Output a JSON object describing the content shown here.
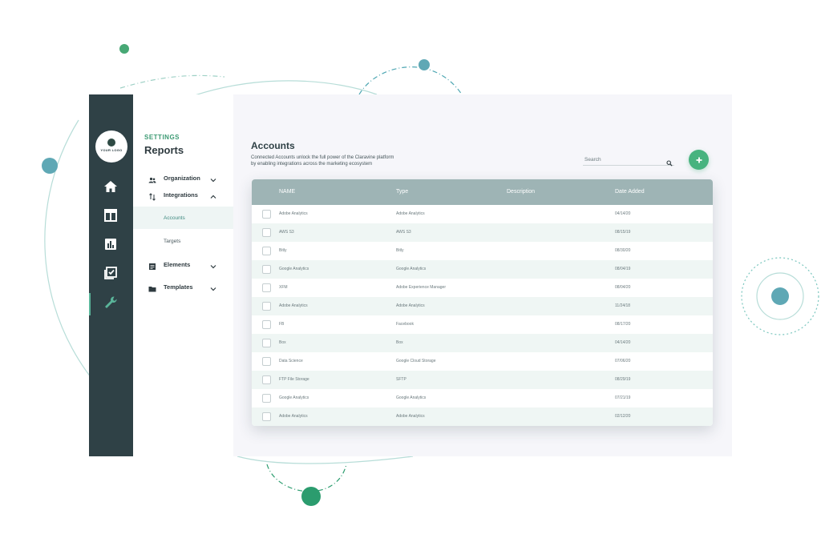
{
  "brand": {
    "logo_text": "YOUR LOGO"
  },
  "rail": {
    "items": [
      {
        "icon": "home-icon"
      },
      {
        "icon": "table-layout-icon"
      },
      {
        "icon": "bar-chart-icon"
      },
      {
        "icon": "checklist-icon"
      },
      {
        "icon": "wrench-icon",
        "active": true
      }
    ]
  },
  "sidebar": {
    "eyebrow": "SETTINGS",
    "title": "Reports",
    "items": [
      {
        "label": "Organization",
        "icon": "users-icon",
        "chevron": "down"
      },
      {
        "label": "Integrations",
        "icon": "sort-arrows-icon",
        "chevron": "up"
      },
      {
        "label": "Elements",
        "icon": "list-icon",
        "chevron": "down"
      },
      {
        "label": "Templates",
        "icon": "folder-icon",
        "chevron": "down"
      }
    ],
    "subitems": [
      {
        "label": "Accounts",
        "active": true
      },
      {
        "label": "Targets",
        "active": false
      }
    ]
  },
  "main": {
    "title": "Accounts",
    "description_line1": "Connected Accounts unlock the full power of the Claravine platform",
    "description_line2": "by enabling integrations across the marketing ecosystem",
    "search_placeholder": "Search"
  },
  "table": {
    "headers": [
      "NAME",
      "Type",
      "Description",
      "Date Added"
    ],
    "rows": [
      {
        "name": "Adobe Analytics",
        "type": "Adobe Analytics",
        "description": "",
        "date": "04/14/20"
      },
      {
        "name": "AWS S3",
        "type": "AWS S3",
        "description": "",
        "date": "08/15/19"
      },
      {
        "name": "Bitly",
        "type": "Bitly",
        "description": "",
        "date": "08/30/20"
      },
      {
        "name": "Google Analytics",
        "type": "Google Analytics",
        "description": "",
        "date": "08/04/19"
      },
      {
        "name": "XFM",
        "type": "Adobe Experience Manager",
        "description": "",
        "date": "08/04/20"
      },
      {
        "name": "Adobe Analytics",
        "type": "Adobe Analytics",
        "description": "",
        "date": "11/24/18"
      },
      {
        "name": "FB",
        "type": "Facebook",
        "description": "",
        "date": "08/17/20"
      },
      {
        "name": "Box",
        "type": "Box",
        "description": "",
        "date": "04/14/20"
      },
      {
        "name": "Data Science",
        "type": "Google Cloud Storage",
        "description": "",
        "date": "07/06/20"
      },
      {
        "name": "FTP File Storage",
        "type": "SFTP",
        "description": "",
        "date": "08/29/19"
      },
      {
        "name": "Google Analytics",
        "type": "Google Analytics",
        "description": "",
        "date": "07/21/19"
      },
      {
        "name": "Adobe Analytics",
        "type": "Adobe Analytics",
        "description": "",
        "date": "02/12/20"
      }
    ]
  },
  "colors": {
    "rail": "#2f4146",
    "accent_green": "#47b37f",
    "teal": "#5fa8b5",
    "table_header": "#9eb4b5",
    "row_alt": "#eff6f4"
  }
}
